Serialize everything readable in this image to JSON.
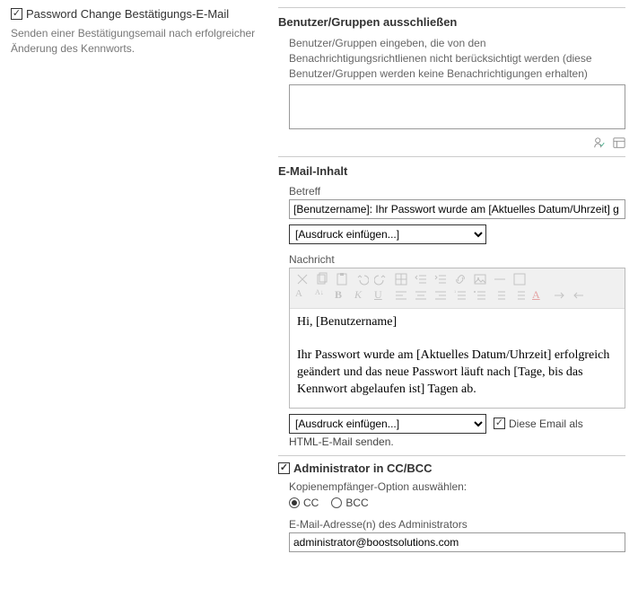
{
  "left": {
    "checkbox_label": "Password Change Bestätigungs-E-Mail",
    "checkbox_checked": true,
    "description": "Senden einer Bestätigungsemail nach erfolgreicher Änderung des Kennworts."
  },
  "exclude": {
    "title": "Benutzer/Gruppen ausschließen",
    "help": "Benutzer/Gruppen eingeben, die von den Benachrichtigungsrichtlienen nicht berücksichtigt werden (diese Benutzer/Gruppen werden keine Benachrichtigungen erhalten)",
    "value": ""
  },
  "content": {
    "title": "E-Mail-Inhalt",
    "subject_label": "Betreff",
    "subject_value": "[Benutzername]: Ihr Passwort wurde am [Aktuelles Datum/Uhrzeit] g",
    "insert_expression": "[Ausdruck einfügen...]",
    "message_label": "Nachricht",
    "message_greeting": "Hi, [Benutzername]",
    "message_body": "Ihr Passwort wurde am [Aktuelles Datum/Uhrzeit] erfolgreich geändert und das neue Passwort läuft nach [Tage, bis das Kennwort abgelaufen ist] Tagen ab.",
    "send_as_html_checkbox": "Diese Email als",
    "send_as_html_tail": "HTML-E-Mail senden.",
    "send_as_html_checked": true
  },
  "admin": {
    "title": "Administrator in CC/BCC",
    "title_checked": true,
    "copy_option_label": "Kopienempfänger-Option auswählen:",
    "cc_label": "CC",
    "bcc_label": "BCC",
    "cc_selected": true,
    "email_label": "E-Mail-Adresse(n) des Administrators",
    "email_value": "administrator@boostsolutions.com"
  }
}
